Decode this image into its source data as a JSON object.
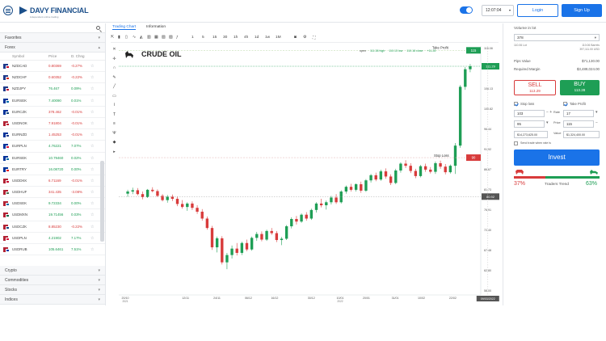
{
  "header": {
    "logo": "DAVY FINANCIAL",
    "logo_sub": "independent online trading",
    "clock": "12:07:04",
    "login_label": "Login",
    "signup_label": "Sign Up"
  },
  "sidebar": {
    "categories_top": [
      {
        "label": "Favorites"
      },
      {
        "label": "Forex"
      }
    ],
    "columns": {
      "symbol": "Symbol",
      "price": "Price",
      "change": "D. Chng"
    },
    "rows": [
      {
        "sym": "NZDCAD",
        "price": "0.80369",
        "chg": "-0.27%",
        "dir": "dn",
        "c1": "#1f3a8a",
        "c2": "#c8102e"
      },
      {
        "sym": "NZDCHF",
        "price": "0.60352",
        "chg": "-0.22%",
        "dir": "dn",
        "c1": "#1f3a8a",
        "c2": "#d52b1e"
      },
      {
        "sym": "NZDJPY",
        "price": "76.467",
        "chg": "0.09%",
        "dir": "up",
        "c1": "#1f3a8a",
        "c2": "#bc002d"
      },
      {
        "sym": "EURSEK",
        "price": "7.40090",
        "chg": "0.01%",
        "dir": "up",
        "c1": "#003399",
        "c2": "#006aa7"
      },
      {
        "sym": "EURCZK",
        "price": "378.462",
        "chg": "-0.01%",
        "dir": "dn",
        "c1": "#003399",
        "c2": "#11457e"
      },
      {
        "sym": "USDNOK",
        "price": "7.91804",
        "chg": "-0.01%",
        "dir": "dn",
        "c1": "#b22234",
        "c2": "#ba0c2f"
      },
      {
        "sym": "EURNZD",
        "price": "1.45253",
        "chg": "-0.01%",
        "dir": "dn",
        "c1": "#003399",
        "c2": "#1f3a8a"
      },
      {
        "sym": "EURPLN",
        "price": "4.76221",
        "chg": "7.07%",
        "dir": "up",
        "c1": "#003399",
        "c2": "#dc143c"
      },
      {
        "sym": "EURSEK",
        "price": "10.79460",
        "chg": "0.02%",
        "dir": "up",
        "c1": "#003399",
        "c2": "#006aa7"
      },
      {
        "sym": "EURTRY",
        "price": "16.08720",
        "chg": "0.00%",
        "dir": "up",
        "c1": "#003399",
        "c2": "#e30a17"
      },
      {
        "sym": "USDDKK",
        "price": "6.71169",
        "chg": "-0.01%",
        "dir": "dn",
        "c1": "#b22234",
        "c2": "#c60c30"
      },
      {
        "sym": "USDHUF",
        "price": "341.435",
        "chg": "-3.08%",
        "dir": "dn",
        "c1": "#b22234",
        "c2": "#477050"
      },
      {
        "sym": "USDSEK",
        "price": "9.72334",
        "chg": "0.00%",
        "dir": "up",
        "c1": "#b22234",
        "c2": "#006aa7"
      },
      {
        "sym": "USDMXN",
        "price": "19.71456",
        "chg": "0.03%",
        "dir": "up",
        "c1": "#b22234",
        "c2": "#006847"
      },
      {
        "sym": "USDCZK",
        "price": "8.85230",
        "chg": "-0.22%",
        "dir": "dn",
        "c1": "#b22234",
        "c2": "#11457e"
      },
      {
        "sym": "USDPLN",
        "price": "4.21902",
        "chg": "7.17%",
        "dir": "up",
        "c1": "#b22234",
        "c2": "#dc143c"
      },
      {
        "sym": "USDRUB",
        "price": "105.6461",
        "chg": "7.51%",
        "dir": "up",
        "c1": "#b22234",
        "c2": "#0039a6"
      }
    ],
    "categories_bottom": [
      {
        "label": "Crypto"
      },
      {
        "label": "Commodities"
      },
      {
        "label": "Stocks"
      },
      {
        "label": "Indices"
      }
    ]
  },
  "chart_panel": {
    "tabs": [
      {
        "label": "Trading Chart"
      },
      {
        "label": "Information"
      }
    ],
    "title": "CRUDE OIL",
    "live": {
      "open": "open",
      "high": "111.38 high",
      "low": "110.13 low",
      "close": "110.18 close",
      "change": "+11.28"
    },
    "toolbar_timeframes": [
      "1",
      "5",
      "15",
      "30",
      "1h",
      "4h",
      "1d",
      "1w",
      "1M"
    ],
    "take_profit_label": "Take Profit",
    "take_profit_price": "115",
    "current_price": "111.29",
    "stop_loss_label": "Stop Loss",
    "stop_loss_price": "90",
    "last_price_tag": "80.92",
    "crosshair_date": "09/03/2022",
    "y_ticks": [
      "116.08",
      "110.78",
      "106.13",
      "100.82",
      "96.44",
      "91.92",
      "86.67",
      "81.73",
      "76.91",
      "72.40",
      "67.48",
      "62.80",
      "58.00"
    ]
  },
  "chart_data": {
    "type": "candlestick",
    "title": "CRUDE OIL",
    "x_ticks": [
      "2021-10-20",
      "2021-11-12",
      "2021-11-24",
      "2021-12-06",
      "2021-12-16",
      "2021-12-30",
      "2022-01-10",
      "2022-01-20",
      "2022-01-31",
      "2022-02-10",
      "2022-02-22"
    ],
    "x_tick_labels": [
      "20/10 2021",
      "12/11",
      "24/11",
      "06/12",
      "16/12",
      "30/12",
      "10/01 2022",
      "20/01",
      "31/01",
      "10/02",
      "22/02"
    ],
    "ylim": [
      58,
      116
    ],
    "candles": [
      [
        81.6,
        82.5,
        80.9,
        82.1
      ],
      [
        82.1,
        83.0,
        81.5,
        82.4
      ],
      [
        82.4,
        82.9,
        81.2,
        81.5
      ],
      [
        81.5,
        82.1,
        80.3,
        80.8
      ],
      [
        80.8,
        82.7,
        80.6,
        82.5
      ],
      [
        82.5,
        83.1,
        81.9,
        82.2
      ],
      [
        82.2,
        82.6,
        80.8,
        81.1
      ],
      [
        81.1,
        81.5,
        79.8,
        80.1
      ],
      [
        80.1,
        81.3,
        79.5,
        80.9
      ],
      [
        80.9,
        81.4,
        79.9,
        80.4
      ],
      [
        80.4,
        80.9,
        78.7,
        79.2
      ],
      [
        79.2,
        80.1,
        78.1,
        78.5
      ],
      [
        78.5,
        79.6,
        77.6,
        79.3
      ],
      [
        79.3,
        79.8,
        77.8,
        78.3
      ],
      [
        78.3,
        78.9,
        76.9,
        77.4
      ],
      [
        77.4,
        78.0,
        75.3,
        75.8
      ],
      [
        75.8,
        76.3,
        73.2,
        73.6
      ],
      [
        73.6,
        74.1,
        68.5,
        69.1
      ],
      [
        69.1,
        71.6,
        67.9,
        71.2
      ],
      [
        71.2,
        71.7,
        65.1,
        65.6
      ],
      [
        65.6,
        67.8,
        64.0,
        67.3
      ],
      [
        67.3,
        69.5,
        66.5,
        68.8
      ],
      [
        68.8,
        70.1,
        67.2,
        67.8
      ],
      [
        67.8,
        70.4,
        67.3,
        70.1
      ],
      [
        70.1,
        70.9,
        68.2,
        68.6
      ],
      [
        68.6,
        71.6,
        68.3,
        71.3
      ],
      [
        71.3,
        72.7,
        70.6,
        72.2
      ],
      [
        72.2,
        72.8,
        70.5,
        70.9
      ],
      [
        70.9,
        73.2,
        70.6,
        72.9
      ],
      [
        72.9,
        73.6,
        72.0,
        72.4
      ],
      [
        72.4,
        72.9,
        70.3,
        70.8
      ],
      [
        70.8,
        71.5,
        69.6,
        71.1
      ],
      [
        71.1,
        74.3,
        70.8,
        74.0
      ],
      [
        74.0,
        76.1,
        73.5,
        75.7
      ],
      [
        75.7,
        76.4,
        74.4,
        75.1
      ],
      [
        75.1,
        77.0,
        74.8,
        76.7
      ],
      [
        76.7,
        77.3,
        75.3,
        75.8
      ],
      [
        75.8,
        78.1,
        75.5,
        77.8
      ],
      [
        77.8,
        79.6,
        77.2,
        79.3
      ],
      [
        79.3,
        80.4,
        78.4,
        78.9
      ],
      [
        78.9,
        80.0,
        77.9,
        79.6
      ],
      [
        79.6,
        81.1,
        79.1,
        80.7
      ],
      [
        80.7,
        81.5,
        79.2,
        79.6
      ],
      [
        79.6,
        82.4,
        79.3,
        82.1
      ],
      [
        82.1,
        83.5,
        81.6,
        83.2
      ],
      [
        83.2,
        83.9,
        82.1,
        82.5
      ],
      [
        82.5,
        84.0,
        82.1,
        83.8
      ],
      [
        83.8,
        84.4,
        81.8,
        82.3
      ],
      [
        82.3,
        85.0,
        82.0,
        84.7
      ],
      [
        84.7,
        86.2,
        84.2,
        85.9
      ],
      [
        85.9,
        86.5,
        84.5,
        84.9
      ],
      [
        84.9,
        87.2,
        84.6,
        86.8
      ],
      [
        86.8,
        87.5,
        85.1,
        85.6
      ],
      [
        85.6,
        86.1,
        83.6,
        84.1
      ],
      [
        84.1,
        87.4,
        83.8,
        87.0
      ],
      [
        87.0,
        88.9,
        86.5,
        88.6
      ],
      [
        88.6,
        89.4,
        87.6,
        88.1
      ],
      [
        88.1,
        88.7,
        86.4,
        86.9
      ],
      [
        86.9,
        87.4,
        85.2,
        85.7
      ],
      [
        85.7,
        88.3,
        85.4,
        88.0
      ],
      [
        88.0,
        88.6,
        86.7,
        87.2
      ],
      [
        87.2,
        87.8,
        86.3,
        86.7
      ],
      [
        86.7,
        89.1,
        86.2,
        88.7
      ],
      [
        88.7,
        89.3,
        87.4,
        87.9
      ],
      [
        87.9,
        88.5,
        86.1,
        86.6
      ],
      [
        86.6,
        88.4,
        86.3,
        88.1
      ],
      [
        88.1,
        93.4,
        86.2,
        92.8
      ],
      [
        92.8,
        106.9,
        92.3,
        106.5
      ],
      [
        106.5,
        111.1,
        105.8,
        110.6
      ],
      [
        110.6,
        111.8,
        109.9,
        111.3
      ]
    ],
    "levels": {
      "take_profit": 115,
      "current": 111.29,
      "stop_loss": 90,
      "last": 80.92
    }
  },
  "trade_panel": {
    "volume_label": "Volume in lot",
    "volume_value": "378",
    "volume_sub1": "110.06 Lot",
    "volume_sub2": "110.06 Barrels",
    "volume_sub3": "397,111.00 USD",
    "pip_label": "Pips Value",
    "pip_value": "$71,130.00",
    "margin_label": "Required Margin",
    "margin_value": "$3,489,024.00",
    "sell_label": "SELL",
    "sell_price": "113.29",
    "buy_label": "BUY",
    "buy_price": "113.28",
    "stop_loss_label": "Stop loss",
    "take_profit_label": "Take Profit",
    "sl_value": "103",
    "tp_value": "17",
    "sl_pips_value": "95",
    "tp_price_label": "Price",
    "tp_price_value": "115",
    "rate_label": "Rate",
    "sl_amount": "$14,273,625.00",
    "tp_amount": "$1,324,400.00",
    "value_label": "Value",
    "trade_opt_label": "Send trade when rate is",
    "invest_label": "Invest",
    "trend_label": "Traders Trend",
    "sell_pct": "37%",
    "buy_pct": "63%",
    "sell_share": 0.37
  }
}
